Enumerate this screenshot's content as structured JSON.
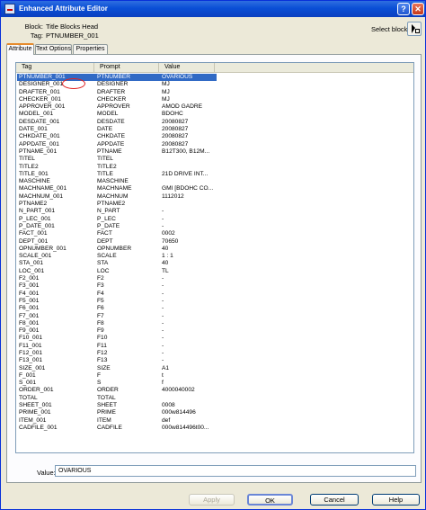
{
  "window": {
    "title": "Enhanced Attribute Editor"
  },
  "titlebar": {
    "help_glyph": "?",
    "close_glyph": "✕"
  },
  "block_info": {
    "block_label": "Block:",
    "block_value": "Title Blocks Head",
    "tag_label": "Tag:",
    "tag_value": "PTNUMBER_001"
  },
  "select_block": {
    "label": "Select block"
  },
  "tabs": [
    {
      "label": "Attribute",
      "active": true
    },
    {
      "label": "Text Options",
      "active": false
    },
    {
      "label": "Properties",
      "active": false
    }
  ],
  "list": {
    "headers": {
      "tag": "Tag",
      "prompt": "Prompt",
      "value": "Value"
    },
    "selected_index": 0,
    "rows": [
      {
        "tag": "PTNUMBER_001",
        "prompt": "PTNUMBER",
        "value": "OVARIOUS"
      },
      {
        "tag": "DESIGNER_001",
        "prompt": "DESIGNER",
        "value": "MJ"
      },
      {
        "tag": "DRAFTER_001",
        "prompt": "DRAFTER",
        "value": "MJ"
      },
      {
        "tag": "CHECKER_001",
        "prompt": "CHECKER",
        "value": "MJ"
      },
      {
        "tag": "APPROVER_001",
        "prompt": "APPROVER",
        "value": "AMOD GADRE"
      },
      {
        "tag": "MODEL_001",
        "prompt": "MODEL",
        "value": "BDOHC"
      },
      {
        "tag": "DESDATE_001",
        "prompt": "DESDATE",
        "value": "20080827"
      },
      {
        "tag": "DATE_001",
        "prompt": "DATE",
        "value": "20080827"
      },
      {
        "tag": "CHKDATE_001",
        "prompt": "CHKDATE",
        "value": "20080827"
      },
      {
        "tag": "APPDATE_001",
        "prompt": "APPDATE",
        "value": "20080827"
      },
      {
        "tag": "PTNAME_001",
        "prompt": "PTNAME",
        "value": "B12T300, B12M..."
      },
      {
        "tag": "TITEL",
        "prompt": "TITEL",
        "value": ""
      },
      {
        "tag": "TITLE2",
        "prompt": "TITLE2",
        "value": ""
      },
      {
        "tag": "TITLE_001",
        "prompt": "TITLE",
        "value": "21D DRIVE INT..."
      },
      {
        "tag": "MASCHINE",
        "prompt": "MASCHINE",
        "value": ""
      },
      {
        "tag": "MACHNAME_001",
        "prompt": "MACHNAME",
        "value": "GMI [BDOHC CO..."
      },
      {
        "tag": "MACHNUM_001",
        "prompt": "MACHNUM",
        "value": "1112012"
      },
      {
        "tag": "PTNAME2",
        "prompt": "PTNAME2",
        "value": ""
      },
      {
        "tag": "N_PART_001",
        "prompt": "N_PART",
        "value": "-"
      },
      {
        "tag": "P_LEC_001",
        "prompt": "P_LEC",
        "value": "-"
      },
      {
        "tag": "P_DATE_001",
        "prompt": "P_DATE",
        "value": "-"
      },
      {
        "tag": "FACT_001",
        "prompt": "FACT",
        "value": "0002"
      },
      {
        "tag": "DEPT_001",
        "prompt": "DEPT",
        "value": "70650"
      },
      {
        "tag": "OPNUMBER_001",
        "prompt": "OPNUMBER",
        "value": "40"
      },
      {
        "tag": "SCALE_001",
        "prompt": "SCALE",
        "value": "1 : 1"
      },
      {
        "tag": "STA_001",
        "prompt": "STA",
        "value": "40"
      },
      {
        "tag": "LOC_001",
        "prompt": "LOC",
        "value": "TL"
      },
      {
        "tag": "F2_001",
        "prompt": "F2",
        "value": "-"
      },
      {
        "tag": "F3_001",
        "prompt": "F3",
        "value": "-"
      },
      {
        "tag": "F4_001",
        "prompt": "F4",
        "value": "-"
      },
      {
        "tag": "F5_001",
        "prompt": "F5",
        "value": "-"
      },
      {
        "tag": "F6_001",
        "prompt": "F6",
        "value": "-"
      },
      {
        "tag": "F7_001",
        "prompt": "F7",
        "value": "-"
      },
      {
        "tag": "F8_001",
        "prompt": "F8",
        "value": "-"
      },
      {
        "tag": "F9_001",
        "prompt": "F9",
        "value": "-"
      },
      {
        "tag": "F10_001",
        "prompt": "F10",
        "value": "-"
      },
      {
        "tag": "F11_001",
        "prompt": "F11",
        "value": "-"
      },
      {
        "tag": "F12_001",
        "prompt": "F12",
        "value": "-"
      },
      {
        "tag": "F13_001",
        "prompt": "F13",
        "value": "-"
      },
      {
        "tag": "SIZE_001",
        "prompt": "SIZE",
        "value": "A1"
      },
      {
        "tag": "F_001",
        "prompt": "F",
        "value": "t"
      },
      {
        "tag": "S_001",
        "prompt": "S",
        "value": "f"
      },
      {
        "tag": "ORDER_001",
        "prompt": "ORDER",
        "value": "4000040002"
      },
      {
        "tag": "TOTAL",
        "prompt": "TOTAL",
        "value": ""
      },
      {
        "tag": "SHEET_001",
        "prompt": "SHEET",
        "value": "0008"
      },
      {
        "tag": "PRIME_001",
        "prompt": "PRIME",
        "value": "000w814496"
      },
      {
        "tag": "ITEM_001",
        "prompt": "ITEM",
        "value": "def"
      },
      {
        "tag": "CADFILE_001",
        "prompt": "CADFILE",
        "value": "000w814496t00..."
      }
    ]
  },
  "value_field": {
    "label": "Value:",
    "value": "OVARIOUS"
  },
  "buttons": {
    "apply": "Apply",
    "ok": "OK",
    "cancel": "Cancel",
    "help": "Help"
  },
  "colors": {
    "title_bar": "#0a4fd6",
    "selection": "#316ac5",
    "annotation_circle": "#e02020",
    "active_tab_accent": "#e68b2c"
  }
}
